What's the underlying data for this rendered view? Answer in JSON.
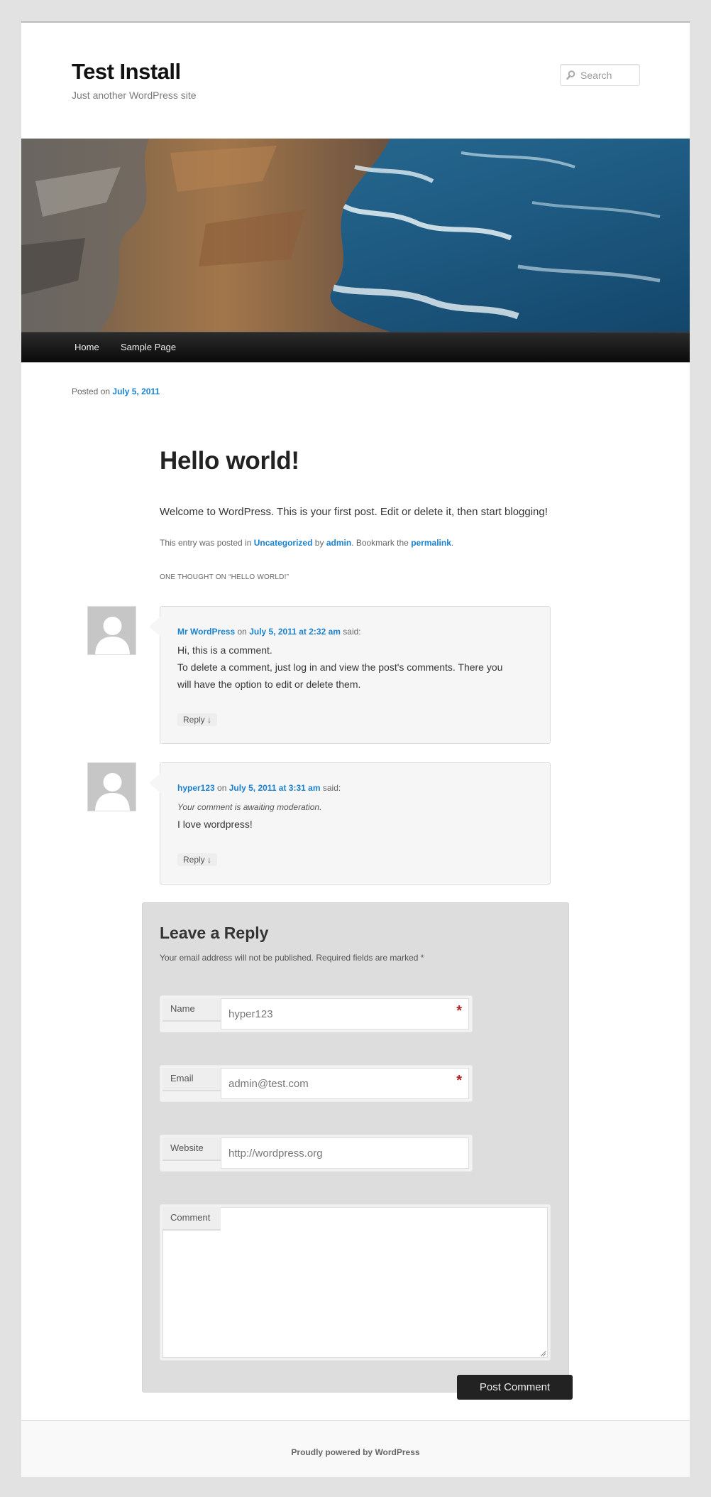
{
  "site": {
    "title": "Test Install",
    "description": "Just another WordPress site"
  },
  "search": {
    "placeholder": "Search",
    "icon": "search-icon"
  },
  "nav": {
    "items": [
      {
        "label": "Home"
      },
      {
        "label": "Sample Page"
      }
    ]
  },
  "post": {
    "posted_on_prefix": "Posted on",
    "date": "July 5, 2011",
    "title": "Hello world!",
    "content": "Welcome to WordPress. This is your first post. Edit or delete it, then start blogging!",
    "meta": {
      "prefix": "This entry was posted in",
      "category": "Uncategorized",
      "by": "by",
      "author": "admin",
      "bookmark": ". Bookmark the",
      "permalink": "permalink",
      "end": "."
    },
    "comments_title": "One thought on “Hello world!”"
  },
  "comments": [
    {
      "author": "Mr WordPress",
      "on": "on",
      "date": "July 5, 2011 at 2:32 am",
      "said": "said:",
      "lines": [
        "Hi, this is a comment.",
        "To delete a comment, just log in and view the post's comments. There you",
        "will have the option to edit or delete them."
      ],
      "reply": "Reply ↓"
    },
    {
      "author": "hyper123",
      "on": "on",
      "date": "July 5, 2011 at 3:31 am",
      "said": "said:",
      "moderation": "Your comment is awaiting moderation.",
      "lines": [
        "I love wordpress!"
      ],
      "reply": "Reply ↓"
    }
  ],
  "respond": {
    "title": "Leave a Reply",
    "note": "Your email address will not be published. Required fields are marked *",
    "fields": {
      "name": {
        "label": "Name",
        "value": "hyper123",
        "required_mark": "*"
      },
      "email": {
        "label": "Email",
        "value": "admin@test.com",
        "required_mark": "*"
      },
      "website": {
        "label": "Website",
        "value": "http://wordpress.org"
      },
      "comment": {
        "label": "Comment",
        "value": ""
      }
    },
    "submit_label": "Post Comment"
  },
  "footer": {
    "text": "Proudly powered by WordPress"
  },
  "colors": {
    "link": "#1982d1",
    "nav_bg": "#111111",
    "required": "#b22222"
  }
}
